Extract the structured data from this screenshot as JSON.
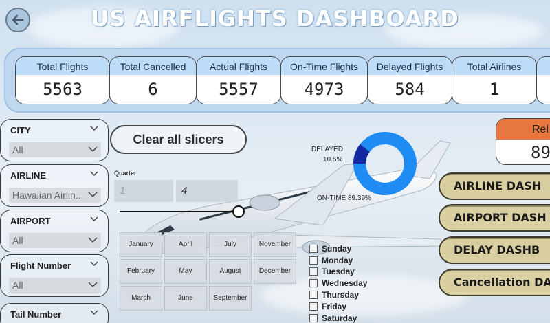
{
  "header": {
    "title": "US AIRFLIGHTS DASHBOARD"
  },
  "kpis": [
    {
      "label": "Total Flights",
      "value": "5563"
    },
    {
      "label": "Total Cancelled",
      "value": "6"
    },
    {
      "label": "Actual Flights",
      "value": "5557"
    },
    {
      "label": "On-Time Flights",
      "value": "4973"
    },
    {
      "label": "Delayed Flights",
      "value": "584"
    },
    {
      "label": "Total Airlines",
      "value": "1"
    }
  ],
  "slicers": [
    {
      "title": "CITY",
      "value": "All"
    },
    {
      "title": "AIRLINE",
      "value": "Hawaiian Airlin..."
    },
    {
      "title": "AIRPORT",
      "value": "All"
    },
    {
      "title": "Flight Number",
      "value": "All"
    },
    {
      "title": "Tail Number",
      "value": ""
    }
  ],
  "clear_button": "Clear all slicers",
  "quarter": {
    "label": "Quarter",
    "min": "1",
    "max": "4"
  },
  "months": [
    [
      "January",
      "April",
      "July",
      "November"
    ],
    [
      "February",
      "May",
      "August",
      "December"
    ],
    [
      "March",
      "June",
      "September"
    ]
  ],
  "days": [
    "Sunday",
    "Monday",
    "Tuesday",
    "Wednesday",
    "Thursday",
    "Friday",
    "Saturday"
  ],
  "donut": {
    "delayed_label": "DELAYED",
    "delayed_pct": "10.5%",
    "ontime_label": "ON-TIME 89.39%",
    "delayed_fraction": 0.105,
    "colors": {
      "delayed": "#1428a0",
      "ontime": "#1e8cf2"
    }
  },
  "reliability": {
    "label": "Rel",
    "value": "89"
  },
  "nav_buttons": [
    "AIRLINE DASH",
    "AIRPORT DASH",
    "DELAY DASHB",
    "Cancellation DA"
  ],
  "colors": {
    "kpi_header": "#bcdcf7",
    "reliability_header": "#e7763f",
    "nav_button": "#d9cfa0"
  }
}
